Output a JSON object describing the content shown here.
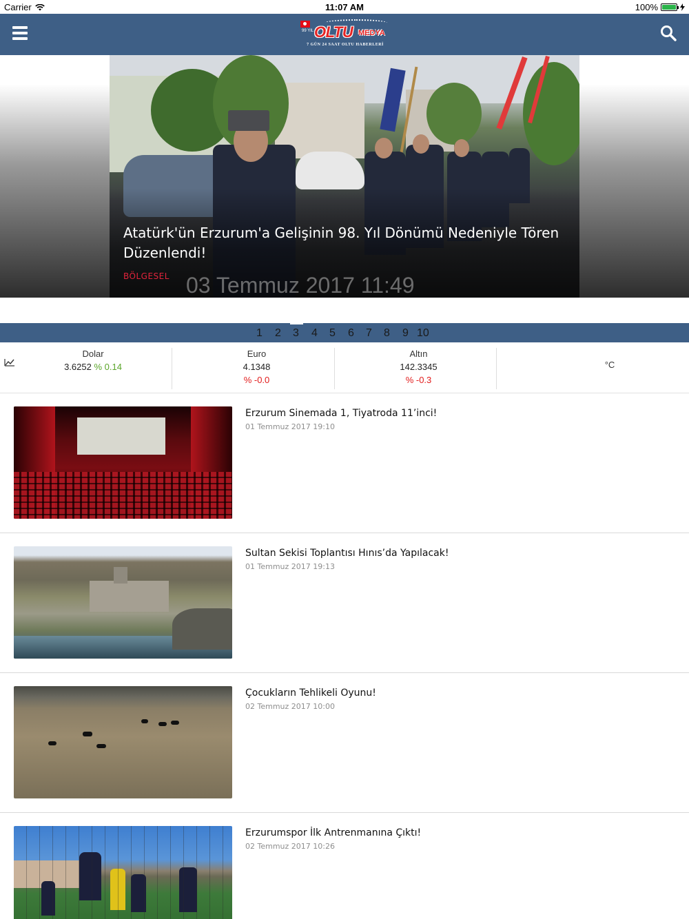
{
  "status_bar": {
    "carrier": "Carrier",
    "time": "11:07 AM",
    "battery": "100%"
  },
  "navbar": {
    "logo": {
      "brand": "OLTU",
      "brand_suffix": "MEDYA",
      "tagline": "7 GÜN 24 SAAT OLTU HABERLERİ",
      "badge": "99 YIL"
    },
    "menu_icon": "hamburger-icon",
    "search_icon": "search-icon",
    "color": "#3e5f86"
  },
  "hero": {
    "title": "Atatürk'ün Erzurum'a Gelişinin 98. Yıl Dönümü Nedeniyle Tören Düzenlendi!",
    "category": "BÖLGESEL",
    "date": "03 Temmuz 2017 11:49",
    "category_color": "#e2233b"
  },
  "pager": {
    "pages": [
      "1",
      "2",
      "3",
      "4",
      "5",
      "6",
      "7",
      "8",
      "9",
      "10"
    ],
    "active": "3"
  },
  "fx": {
    "icon": "chart-icon",
    "items": [
      {
        "label": "Dolar",
        "value": "3.6252",
        "change": "% 0.14",
        "trend": "up"
      },
      {
        "label": "Euro",
        "value": "4.1348",
        "change": "% -0.0",
        "trend": "down"
      },
      {
        "label": "Altın",
        "value": "142.3345",
        "change": "% -0.3",
        "trend": "down"
      }
    ],
    "weather": "°C"
  },
  "news": [
    {
      "title": "Erzurum Sinemada 1, Tiyatroda 11’inci!",
      "date": "01 Temmuz 2017 19:10",
      "image": "cinema-hall"
    },
    {
      "title": "Sultan Sekisi Toplantısı Hınıs’da Yapılacak!",
      "date": "01 Temmuz 2017 19:13",
      "image": "stone-monument-river"
    },
    {
      "title": "Çocukların Tehlikeli Oyunu!",
      "date": "02 Temmuz 2017 10:00",
      "image": "children-swimming-river"
    },
    {
      "title": "Erzurumspor İlk Antrenmanına Çıktı!",
      "date": "02 Temmuz 2017 10:26",
      "image": "football-training"
    }
  ]
}
